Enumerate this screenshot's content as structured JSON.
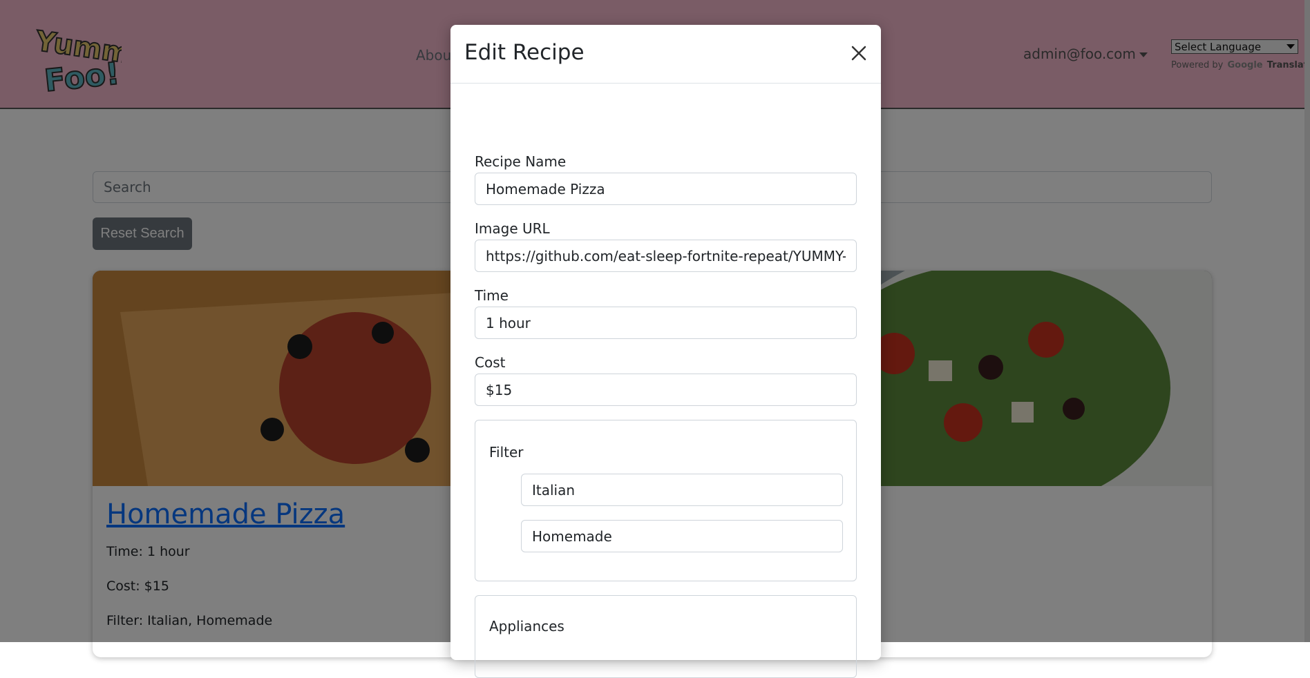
{
  "nav": {
    "about_label": "About",
    "user_email": "admin@foo.com",
    "language_select": "Select Language",
    "powered_by": "Powered by",
    "google": "Google",
    "translate": "Translate"
  },
  "search": {
    "placeholder": "Search",
    "reset_label": "Reset Search"
  },
  "card": {
    "title": "Homemade Pizza",
    "time": "Time: 1 hour",
    "cost": "Cost: $15",
    "filter": "Filter: Italian, Homemade"
  },
  "modal": {
    "title": "Edit Recipe",
    "fields": {
      "recipe_name_label": "Recipe Name",
      "recipe_name_value": "Homemade Pizza",
      "image_url_label": "Image URL",
      "image_url_value": "https://github.com/eat-sleep-fortnite-repeat/YUMMY-FOO/",
      "time_label": "Time",
      "time_value": "1 hour",
      "cost_label": "Cost",
      "cost_value": "$15"
    },
    "filter": {
      "legend": "Filter",
      "values": [
        "Italian",
        "Homemade"
      ]
    },
    "appliances": {
      "legend": "Appliances"
    }
  },
  "colors": {
    "navbar": "#f4b8cc",
    "link": "#0d6efd",
    "secondary_button": "#6c757d"
  }
}
